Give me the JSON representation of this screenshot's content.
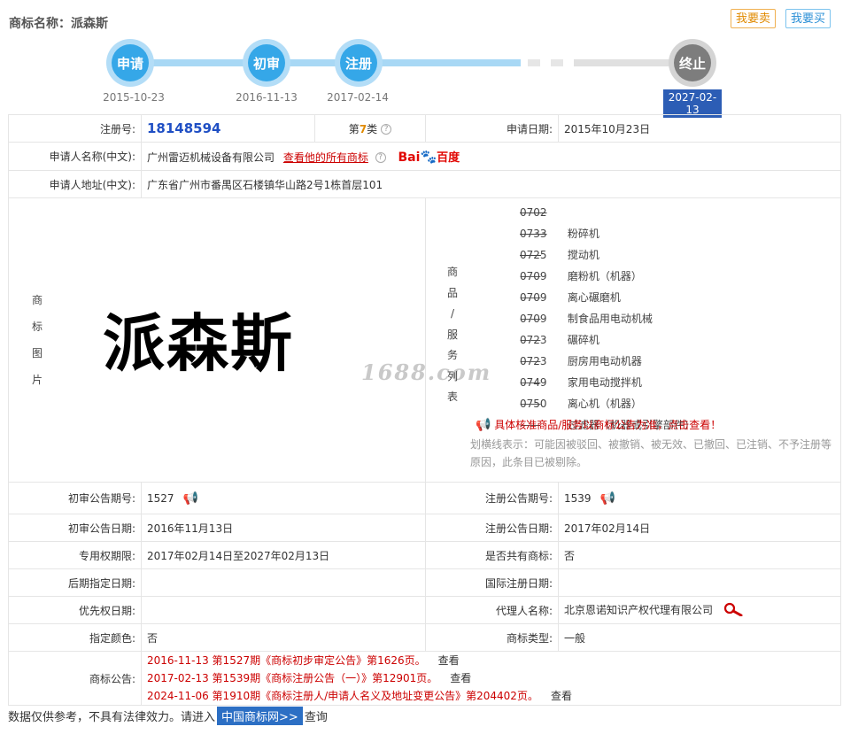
{
  "header": {
    "title": "商标名称：派森斯",
    "sell_label": "我要卖",
    "buy_label": "我要买"
  },
  "timeline": {
    "steps": [
      {
        "label": "申请",
        "date": "2015-10-23"
      },
      {
        "label": "初审",
        "date": "2016-11-13"
      },
      {
        "label": "注册",
        "date": "2017-02-14"
      },
      {
        "label": "终止",
        "date": "2027-02-13"
      }
    ]
  },
  "info": {
    "reg_no_label": "注册号:",
    "reg_no": "18148594",
    "class_prefix": "第",
    "class_num": "7",
    "class_suffix": "类",
    "apply_date_label": "申请日期:",
    "apply_date": "2015年10月23日",
    "applicant_label": "申请人名称(中文):",
    "applicant": "广州雷迈机械设备有限公司",
    "all_marks_link": "查看他的所有商标",
    "baidu_b1": "Bai",
    "baidu_b2": "百度",
    "address_label": "申请人地址(中文):",
    "address": "广东省广州市番禺区石楼镇华山路2号1栋首层101",
    "image_label_chars": [
      "商",
      "标",
      "图",
      "片"
    ],
    "mark_text": "派森斯",
    "watermark": "1688.com",
    "goods_label_chars": [
      "商",
      "品",
      "/",
      "服",
      "务",
      "列",
      "表"
    ],
    "goods": [
      {
        "code": "0702",
        "name": "粉碎机",
        "strike": true
      },
      {
        "code": "0733",
        "name": "搅动机",
        "strike": true
      },
      {
        "code": "0725",
        "name": "磨粉机（机器）",
        "strike": false
      },
      {
        "code": "0709",
        "name": "离心碾磨机",
        "strike": false
      },
      {
        "code": "0709",
        "name": "制食品用电动机械",
        "strike": false
      },
      {
        "code": "0709",
        "name": "碾碎机",
        "strike": false
      },
      {
        "code": "0723",
        "name": "厨房用电动机器",
        "strike": false
      },
      {
        "code": "0723",
        "name": "家用电动搅拌机",
        "strike": false
      },
      {
        "code": "0749",
        "name": "离心机（机器）",
        "strike": false
      },
      {
        "code": "0750",
        "name": "过滤器（机器或引擎部件）",
        "strike": false
      }
    ],
    "goods_dash": "——",
    "goods_notice": "具体核准商品/服务以商标公告为准，点击查看！",
    "strike_note": "划横线表示：可能因被驳回、被撤销、被无效、已撤回、已注销、不予注册等原因，此条目已被剔除。",
    "prelim_no_label": "初审公告期号:",
    "prelim_no": "1527",
    "reg_pub_no_label": "注册公告期号:",
    "reg_pub_no": "1539",
    "prelim_date_label": "初审公告日期:",
    "prelim_date": "2016年11月13日",
    "reg_pub_date_label": "注册公告日期:",
    "reg_pub_date": "2017年02月14日",
    "exclusive_label": "专用权期限:",
    "exclusive": "2017年02月14日至2027年02月13日",
    "shared_label": "是否共有商标:",
    "shared": "否",
    "later_label": "后期指定日期:",
    "later": "",
    "intl_label": "国际注册日期:",
    "intl": "",
    "priority_label": "优先权日期:",
    "priority": "",
    "agent_label": "代理人名称:",
    "agent": "北京恩诺知识产权代理有限公司",
    "color_label": "指定颜色:",
    "color": "否",
    "type_label": "商标类型:",
    "type": "一般",
    "announce_label": "商标公告:",
    "announcements": [
      {
        "text": "2016-11-13 第1527期《商标初步审定公告》第1626页。",
        "see": "查看"
      },
      {
        "text": "2017-02-13 第1539期《商标注册公告（一）》第12901页。",
        "see": "查看"
      },
      {
        "text": "2024-11-06 第1910期《商标注册人/申请人名义及地址变更公告》第204402页。",
        "see": "查看"
      }
    ]
  },
  "footer": {
    "prefix": "数据仅供参考，不具有法律效力。请进入",
    "link": "中国商标网>>",
    "suffix": "查询"
  },
  "colors": {
    "step_blue": "#35a7e8",
    "step_gray": "#7d7d7d",
    "reg_no_blue": "#1f4fc4",
    "alert_red": "#cc0000"
  }
}
